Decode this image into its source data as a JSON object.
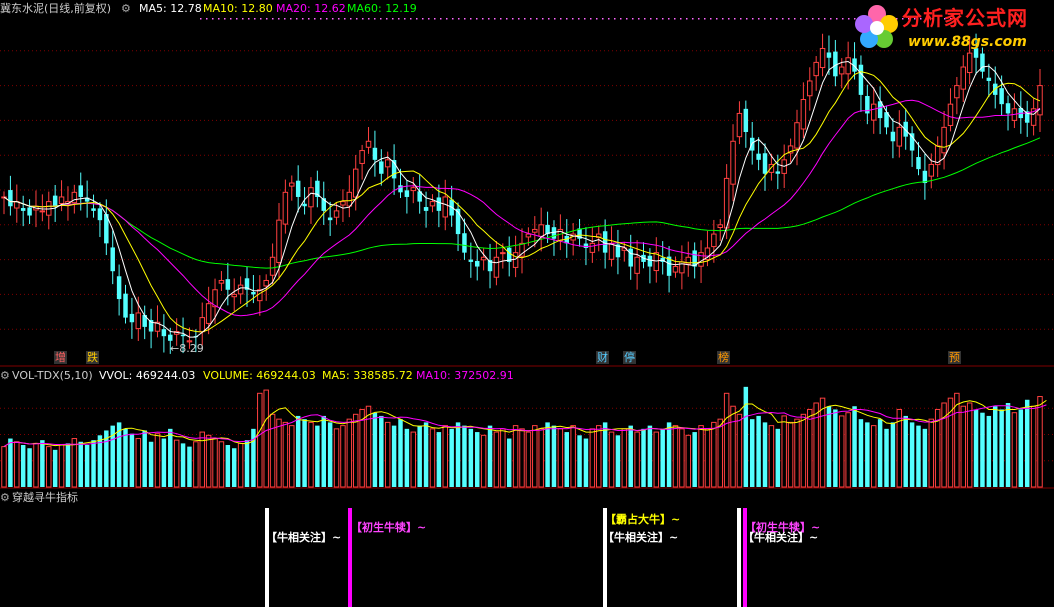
{
  "header": {
    "title": "冀东水泥(日线,前复权)",
    "ma5": "MA5: 12.78",
    "ma10": "MA10: 12.80",
    "ma20": "MA20: 12.62",
    "ma60": "MA60: 12.19",
    "colors": {
      "ma5": "#ffffff",
      "ma10": "#ffff00",
      "ma20": "#ff00ff",
      "ma60": "#00ff00"
    }
  },
  "watermark": {
    "site_name": "分析家公式网",
    "url": "www.88gs.com"
  },
  "price_panel": {
    "low_marker": "8.29",
    "event_markers": [
      {
        "text": "增",
        "color": "#ff6060"
      },
      {
        "text": "跌",
        "color": "#ffcc00"
      },
      {
        "text": "财",
        "color": "#55ccff"
      },
      {
        "text": "停",
        "color": "#55ccff"
      },
      {
        "text": "榜",
        "color": "#ff9900"
      },
      {
        "text": "预",
        "color": "#ff9900"
      }
    ]
  },
  "volume_panel": {
    "indicator": "VOL-TDX(5,10)",
    "vvol": "VVOL: 469244.03",
    "volume": "VOLUME: 469244.03",
    "ma5": "MA5: 338585.72",
    "ma10": "MA10: 372502.91"
  },
  "signal_panel": {
    "title": "穿越寻牛指标",
    "signals": [
      {
        "text": "【牛相关注】~",
        "color": "#ffffff",
        "bar_color": "#ffffff"
      },
      {
        "text": "【初生牛犊】~",
        "color": "#ff44ff",
        "bar_color": "#ff00ff"
      },
      {
        "text": "【霸占大牛】~",
        "color": "#ffff00",
        "bar_color": "#ffff00"
      },
      {
        "text": "【牛相关注】~",
        "color": "#ffffff",
        "bar_color": "#ffffff"
      },
      {
        "text": "【初生牛犊】~",
        "color": "#ff44ff",
        "bar_color": "#ff00ff"
      },
      {
        "text": "【牛相关注】~",
        "color": "#ffffff",
        "bar_color": "#ffffff"
      }
    ]
  },
  "chart_data": {
    "type": "candlestick",
    "colors": {
      "up": "#ff4040",
      "down": "#54ffff",
      "grid": "#800000"
    },
    "closes": [
      11.6,
      11.4,
      11.5,
      11.3,
      11.2,
      11.4,
      11.3,
      11.5,
      11.4,
      11.6,
      11.5,
      11.7,
      11.6,
      11.5,
      11.3,
      11.1,
      10.6,
      10.0,
      9.4,
      9.0,
      8.9,
      9.1,
      8.8,
      8.7,
      8.9,
      8.6,
      8.5,
      8.7,
      8.6,
      8.5,
      8.6,
      9.0,
      9.3,
      9.6,
      9.8,
      9.6,
      9.5,
      9.7,
      9.6,
      9.5,
      9.6,
      9.8,
      10.3,
      11.1,
      11.7,
      11.9,
      11.6,
      11.4,
      11.8,
      11.6,
      11.3,
      11.1,
      11.3,
      11.5,
      11.7,
      12.2,
      12.6,
      12.8,
      12.4,
      12.1,
      12.4,
      12.0,
      11.7,
      11.6,
      11.8,
      11.5,
      11.3,
      11.5,
      11.3,
      11.6,
      11.2,
      10.8,
      10.4,
      10.2,
      10.1,
      10.3,
      10.0,
      10.3,
      10.4,
      10.2,
      10.4,
      10.6,
      10.8,
      10.9,
      11.0,
      10.8,
      10.7,
      10.9,
      10.6,
      10.8,
      10.7,
      10.5,
      10.6,
      10.8,
      10.4,
      10.6,
      10.3,
      10.5,
      10.1,
      10.3,
      10.2,
      10.1,
      10.4,
      10.2,
      9.9,
      10.1,
      10.2,
      10.3,
      10.1,
      10.4,
      10.5,
      10.8,
      11.0,
      12.0,
      12.8,
      13.4,
      13.0,
      12.6,
      12.4,
      12.1,
      12.3,
      12.1,
      12.4,
      12.7,
      13.2,
      13.7,
      14.1,
      14.5,
      14.8,
      14.6,
      14.2,
      14.4,
      14.6,
      14.3,
      13.8,
      13.4,
      13.6,
      13.3,
      13.1,
      12.8,
      13.1,
      12.9,
      12.6,
      12.2,
      11.9,
      12.3,
      12.7,
      13.1,
      13.6,
      14.0,
      14.4,
      14.7,
      14.6,
      14.3,
      14.1,
      13.8,
      13.6,
      13.4,
      13.5,
      13.3,
      13.2,
      13.5,
      14.0
    ],
    "volumes": [
      25,
      30,
      28,
      26,
      24,
      27,
      29,
      25,
      23,
      26,
      27,
      30,
      28,
      26,
      29,
      32,
      35,
      38,
      40,
      36,
      33,
      30,
      35,
      28,
      33,
      30,
      36,
      29,
      27,
      25,
      28,
      34,
      32,
      30,
      28,
      26,
      24,
      27,
      29,
      36,
      58,
      60,
      45,
      42,
      40,
      38,
      44,
      42,
      40,
      38,
      44,
      40,
      36,
      38,
      42,
      45,
      48,
      50,
      46,
      44,
      40,
      38,
      42,
      36,
      34,
      38,
      40,
      36,
      34,
      38,
      36,
      40,
      38,
      36,
      34,
      32,
      38,
      34,
      36,
      30,
      38,
      36,
      34,
      38,
      36,
      40,
      38,
      36,
      34,
      38,
      32,
      30,
      36,
      38,
      40,
      34,
      32,
      36,
      38,
      34,
      36,
      38,
      34,
      36,
      40,
      38,
      36,
      32,
      34,
      38,
      36,
      40,
      42,
      58,
      50,
      45,
      62,
      42,
      44,
      40,
      38,
      36,
      44,
      40,
      42,
      45,
      48,
      52,
      55,
      50,
      48,
      44,
      46,
      50,
      42,
      40,
      38,
      42,
      36,
      40,
      48,
      44,
      40,
      38,
      36,
      42,
      48,
      52,
      55,
      58,
      50,
      52,
      48,
      46,
      44,
      50,
      48,
      52,
      46,
      48,
      54,
      50,
      56,
      60
    ],
    "ylim": [
      8.0,
      15.5
    ]
  }
}
